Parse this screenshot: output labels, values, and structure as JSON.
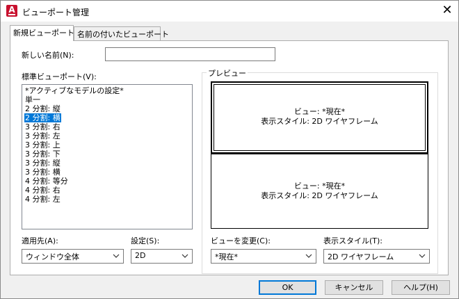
{
  "window": {
    "title": "ビューポート管理",
    "close_glyph": "✕",
    "app_icon_letter": "A"
  },
  "tabs": [
    {
      "label": "新規ビューポート",
      "active": true
    },
    {
      "label": "名前の付いたビューポート",
      "active": false
    }
  ],
  "new_name": {
    "label": "新しい名前(N):",
    "value": ""
  },
  "standard_viewports": {
    "label": "標準ビューポート(V):",
    "items": [
      "*アクティブなモデルの設定*",
      "単一",
      "2 分割: 縦",
      "2 分割: 横",
      "3 分割: 右",
      "3 分割: 左",
      "3 分割: 上",
      "3 分割: 下",
      "3 分割: 縦",
      "3 分割: 横",
      "4 分割: 等分",
      "4 分割: 右",
      "4 分割: 左"
    ],
    "selected_index": 3
  },
  "preview": {
    "label": "プレビュー",
    "viewports": [
      {
        "view": "ビュー: *現在*",
        "style": "表示スタイル: 2D ワイヤフレーム",
        "active": true
      },
      {
        "view": "ビュー: *現在*",
        "style": "表示スタイル: 2D ワイヤフレーム",
        "active": false
      }
    ]
  },
  "apply_to": {
    "label": "適用先(A):",
    "value": "ウィンドウ全体"
  },
  "setup": {
    "label": "設定(S):",
    "value": "2D"
  },
  "change_view": {
    "label": "ビューを変更(C):",
    "value": "*現在*"
  },
  "visual_style": {
    "label": "表示スタイル(T):",
    "value": "2D ワイヤフレーム"
  },
  "buttons": {
    "ok": "OK",
    "cancel": "キャンセル",
    "help": "ヘルプ(H)"
  },
  "colors": {
    "selection": "#0078d7",
    "app_icon": "#c8102e",
    "default_button_border": "#0078d7"
  }
}
